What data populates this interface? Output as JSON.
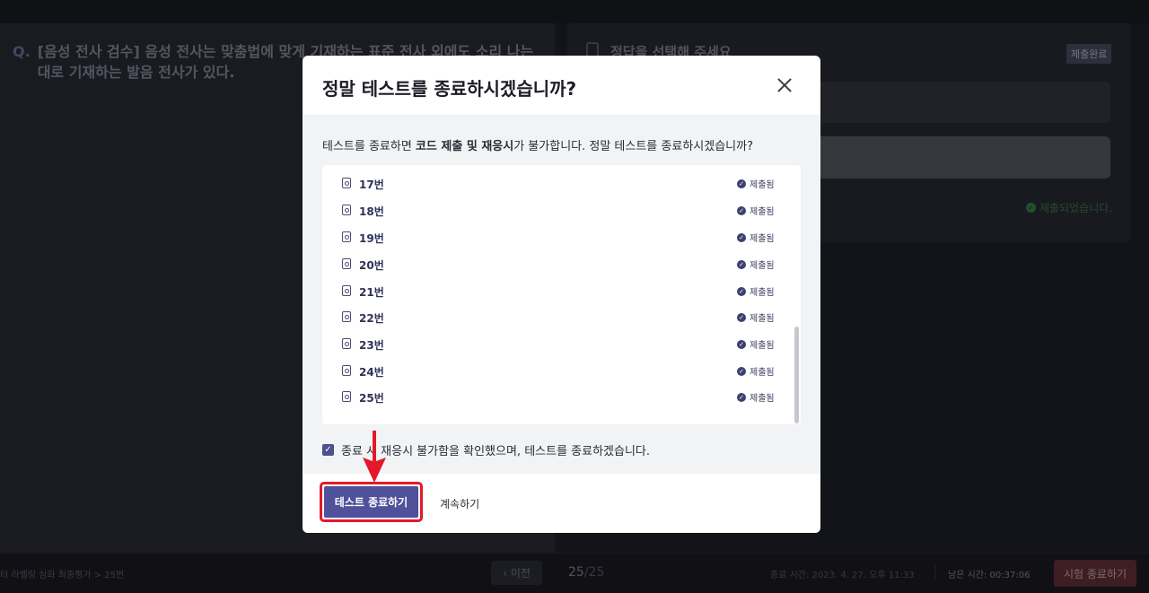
{
  "question": {
    "mark": "Q.",
    "text": "[음성 전사 검수] 음성 전사는 맞춤법에 맞게 기재하는 표준 전사 외에도 소리 나는 대로 기재하는 발음 전사가 있다."
  },
  "answer_panel": {
    "title": "정답을 선택해 주세요",
    "badge": "제출완료",
    "status": "제출되었습니다."
  },
  "bottom": {
    "breadcrumb": "터 라벨링 심화 최종평가  >  25번",
    "prev_label": "이전",
    "current_page": "25",
    "total_pages": "/25",
    "end_time": "종료 시간: 2023. 4. 27. 오후 11:33",
    "remaining": "남은 시간: 00:37:06",
    "exam_end_label": "시험 종료하기"
  },
  "modal": {
    "title": "정말 테스트를 종료하시겠습니까?",
    "desc_prefix": "테스트를 종료하면 ",
    "desc_bold": "코드 제출 및 재응시",
    "desc_suffix": "가 불가합니다. 정말 테스트를 종료하시겠습니까?",
    "items": [
      {
        "label": "17번",
        "status": "제출됨"
      },
      {
        "label": "18번",
        "status": "제출됨"
      },
      {
        "label": "19번",
        "status": "제출됨"
      },
      {
        "label": "20번",
        "status": "제출됨"
      },
      {
        "label": "21번",
        "status": "제출됨"
      },
      {
        "label": "22번",
        "status": "제출됨"
      },
      {
        "label": "23번",
        "status": "제출됨"
      },
      {
        "label": "24번",
        "status": "제출됨"
      },
      {
        "label": "25번",
        "status": "제출됨"
      }
    ],
    "confirm_text": "종료 시 재응시 불가함을 확인했으며, 테스트를 종료하겠습니다.",
    "confirm_checked": true,
    "end_button": "테스트 종료하기",
    "continue_button": "계속하기"
  },
  "colors": {
    "accent": "#4f519a",
    "highlight": "#e3192a"
  }
}
